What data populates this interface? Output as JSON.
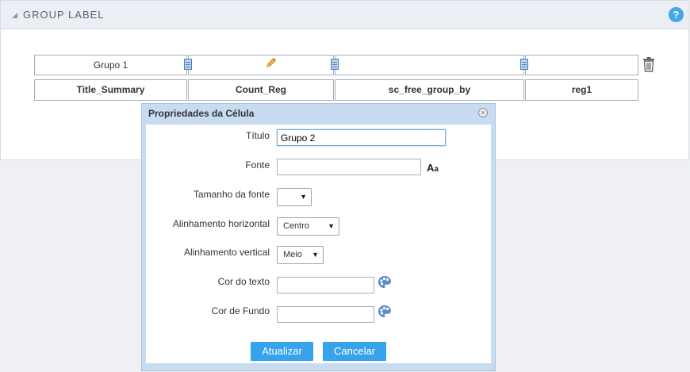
{
  "panel": {
    "title": "GROUP LABEL",
    "help_glyph": "?",
    "icons": [
      "collapse-triangle-icon",
      "help-icon"
    ]
  },
  "grid": {
    "group_row": [
      "Grupo 1",
      "",
      "",
      ""
    ],
    "field_row": [
      "Title_Summary",
      "Count_Reg",
      "sc_free_group_by",
      "reg1"
    ],
    "icons": [
      "pencil-icon",
      "trash-icon",
      "column-handle-icon"
    ]
  },
  "dialog": {
    "title": "Propriedades da Célula",
    "fields": {
      "titulo_label": "Título",
      "titulo_value": "Grupo 2",
      "fonte_label": "Fonte",
      "fonte_value": "",
      "fonte_icon_big": "A",
      "fonte_icon_small": "a",
      "tamanho_label": "Tamanho da fonte",
      "tamanho_value": "",
      "alinh_h_label": "Alinhamento horizontal",
      "alinh_h_value": "Centro",
      "alinh_v_label": "Alinhamento vertical",
      "alinh_v_value": "Meio",
      "cor_texto_label": "Cor do texto",
      "cor_texto_value": "",
      "cor_fundo_label": "Cor de Fundo",
      "cor_fundo_value": ""
    },
    "buttons": {
      "update": "Atualizar",
      "cancel": "Cancelar"
    },
    "arrow_glyph": "▼",
    "close_glyph": "×"
  },
  "colors": {
    "accent": "#36a3eb",
    "dialog_frame": "#c7dbf1",
    "header_bg": "#ebeff5"
  }
}
